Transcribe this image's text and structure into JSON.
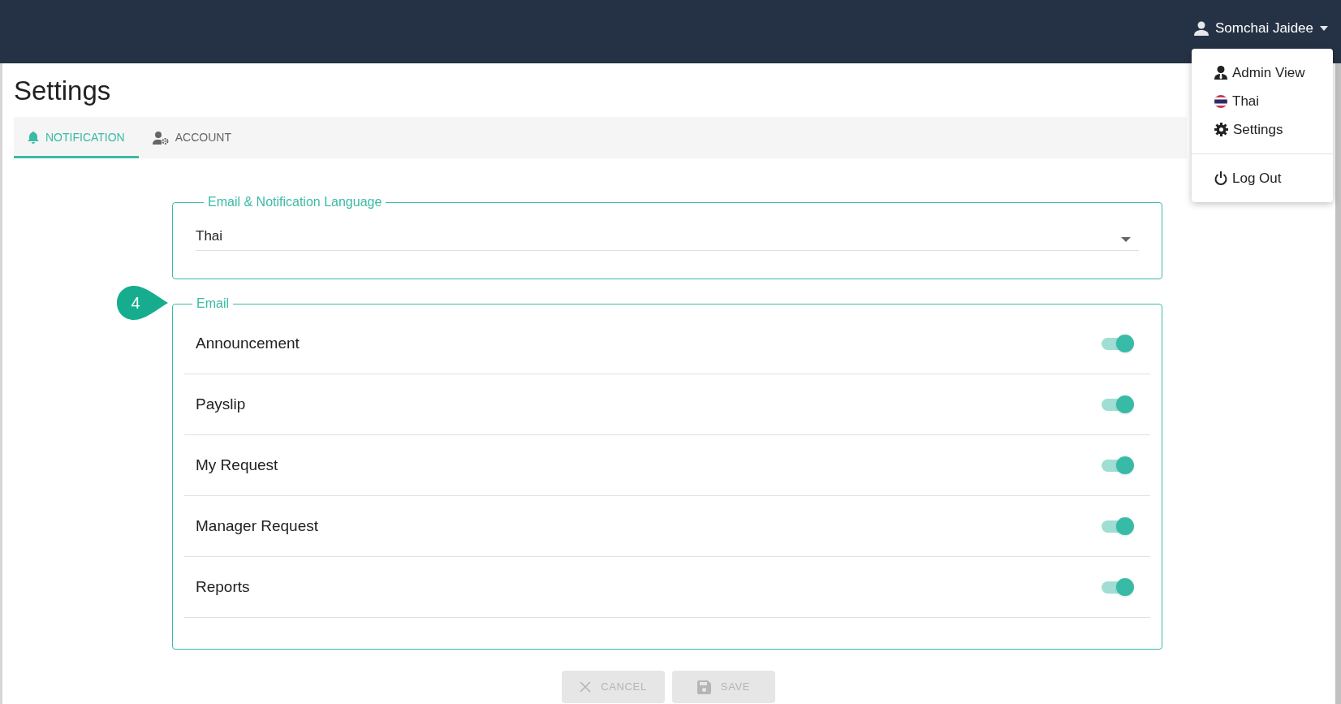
{
  "header": {
    "user_name": "Somchai Jaidee"
  },
  "user_menu": {
    "items": [
      {
        "kind": "admin",
        "label": "Admin View"
      },
      {
        "kind": "flag",
        "label": "Thai"
      },
      {
        "kind": "settings",
        "label": "Settings"
      },
      {
        "kind": "logout",
        "label": "Log Out"
      }
    ]
  },
  "page_title": "Settings",
  "tabs": [
    {
      "kind": "bell",
      "label": "NOTIFICATION",
      "selected": true
    },
    {
      "kind": "account",
      "label": "ACCOUNT",
      "selected": false
    }
  ],
  "language_section": {
    "legend": "Email & Notification Language",
    "value": "Thai"
  },
  "step_marker": "4",
  "email_section": {
    "legend": "Email",
    "items": [
      {
        "label": "Announcement",
        "on": true
      },
      {
        "label": "Payslip",
        "on": true
      },
      {
        "label": "My Request",
        "on": true
      },
      {
        "label": "Manager Request",
        "on": true
      },
      {
        "label": "Reports",
        "on": true
      }
    ]
  },
  "buttons": [
    {
      "kind": "cancel",
      "label": "CANCEL",
      "disabled": true
    },
    {
      "kind": "save",
      "label": "SAVE",
      "disabled": true
    }
  ]
}
